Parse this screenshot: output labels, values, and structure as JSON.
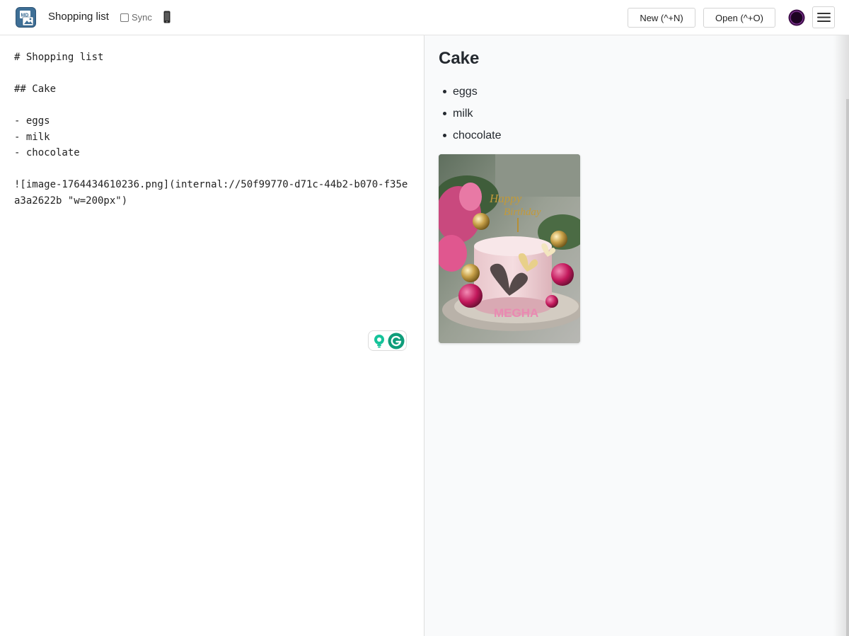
{
  "header": {
    "doc_title": "Shopping list",
    "sync_label": "Sync",
    "sync_checked": false,
    "new_button_label": "New (^+N)",
    "open_button_label": "Open (^+O)",
    "icons": {
      "logo": "markdown-app-logo",
      "device": "mobile-phone-icon",
      "theme": "theme-toggle-icon",
      "menu": "hamburger-menu-icon"
    },
    "colors": {
      "logo": "#3e6f96",
      "theme_icon": "#3b0a45"
    }
  },
  "editor": {
    "text": "# Shopping list\n\n## Cake\n\n- eggs\n- milk\n- chocolate\n\n![image-1764434610236.png](internal://50f99770-d71c-44b2-b070-f35ea3a2622b \"w=200px\")"
  },
  "grammarly": {
    "icons": [
      "bulb-icon",
      "grammarly-logo-icon"
    ],
    "color": "#15c39a"
  },
  "preview": {
    "heading": "Cake",
    "items": [
      "eggs",
      "milk",
      "chocolate"
    ],
    "image": {
      "subject": "birthday cake photo",
      "alt": "image-1764434610236.png"
    }
  }
}
